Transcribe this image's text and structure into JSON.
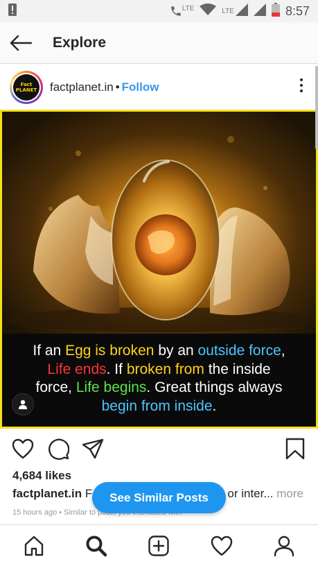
{
  "status_bar": {
    "time": "8:57",
    "lte_label_1": "LTE",
    "lte_label_2": "LTE",
    "icons": [
      "alert-icon",
      "call-lte-icon",
      "wifi-icon",
      "signal-icon",
      "signal-icon",
      "battery-low-icon"
    ],
    "battery_color": "#e53935"
  },
  "header": {
    "title": "Explore",
    "back_icon": "arrow-left-icon"
  },
  "post": {
    "username": "factplanet.in",
    "separator": "•",
    "follow_label": "Follow",
    "avatar_text_1": "Fact",
    "avatar_text_2": "PLANET",
    "image_caption": {
      "l1_a": "If an ",
      "l1_b": "Egg is broken",
      "l1_c": " by an ",
      "l1_d": "outside force",
      "l1_e": ",",
      "l2_a": "Life ends",
      "l2_b": ". If ",
      "l2_c": "broken from",
      "l2_d": " the inside",
      "l3_a": "force, ",
      "l3_b": "Life begins",
      "l3_c": ". Great things always",
      "l4_a": "begin from inside",
      "l4_b": "."
    },
    "likes": "4,684 likes",
    "caption_user": "factplanet.in",
    "caption_text": "F",
    "caption_tail": "or inter...",
    "caption_more": "more",
    "meta": "15 hours ago • Similar to posts you interacted with",
    "similar_button": "See Similar Posts"
  },
  "colors": {
    "accent": "#3897f0",
    "similar_button": "#1e96f0",
    "image_border": "#f3e11b",
    "caption_yellow": "#ffd21e",
    "caption_blue": "#4bc6ff",
    "caption_red": "#ff3434",
    "caption_green": "#5ae34c"
  },
  "actions": [
    "heart-icon",
    "comment-icon",
    "share-icon",
    "bookmark-icon"
  ],
  "bottom_nav": [
    "home-icon",
    "search-icon",
    "add-post-icon",
    "activity-heart-icon",
    "profile-icon"
  ]
}
